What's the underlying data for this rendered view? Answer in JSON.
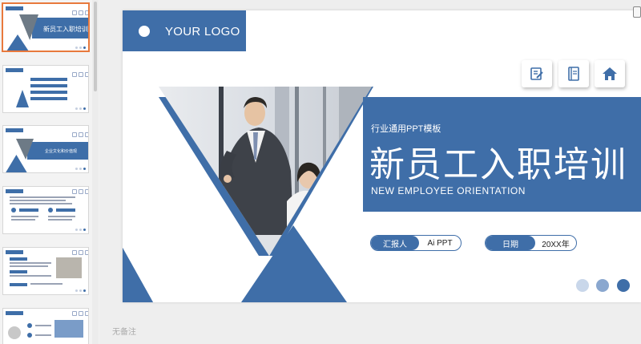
{
  "slide": {
    "logo_text": "YOUR LOGO",
    "subtitle_small": "行业通用PPT模板",
    "title": "新员工入职培训",
    "subtitle_en": "NEW EMPLOYEE ORIENTATION",
    "reporter_label": "汇报人",
    "reporter_value": "Ai PPT",
    "date_label": "日期",
    "date_value": "20XX年",
    "nav_icons": [
      "edit-icon",
      "book-icon",
      "home-icon"
    ],
    "page_dots": [
      {
        "color": "#c9d7ea"
      },
      {
        "color": "#8aa7cf"
      },
      {
        "color": "#3f6ea8"
      }
    ],
    "accent_color": "#3f6ea8"
  },
  "thumbnails": [
    {
      "title": "新员工入职培训"
    },
    {
      "items": [
        "",
        "",
        "",
        ""
      ]
    },
    {
      "title": "企业文化和价值观"
    },
    {},
    {},
    {}
  ],
  "notes_placeholder": "无备注"
}
